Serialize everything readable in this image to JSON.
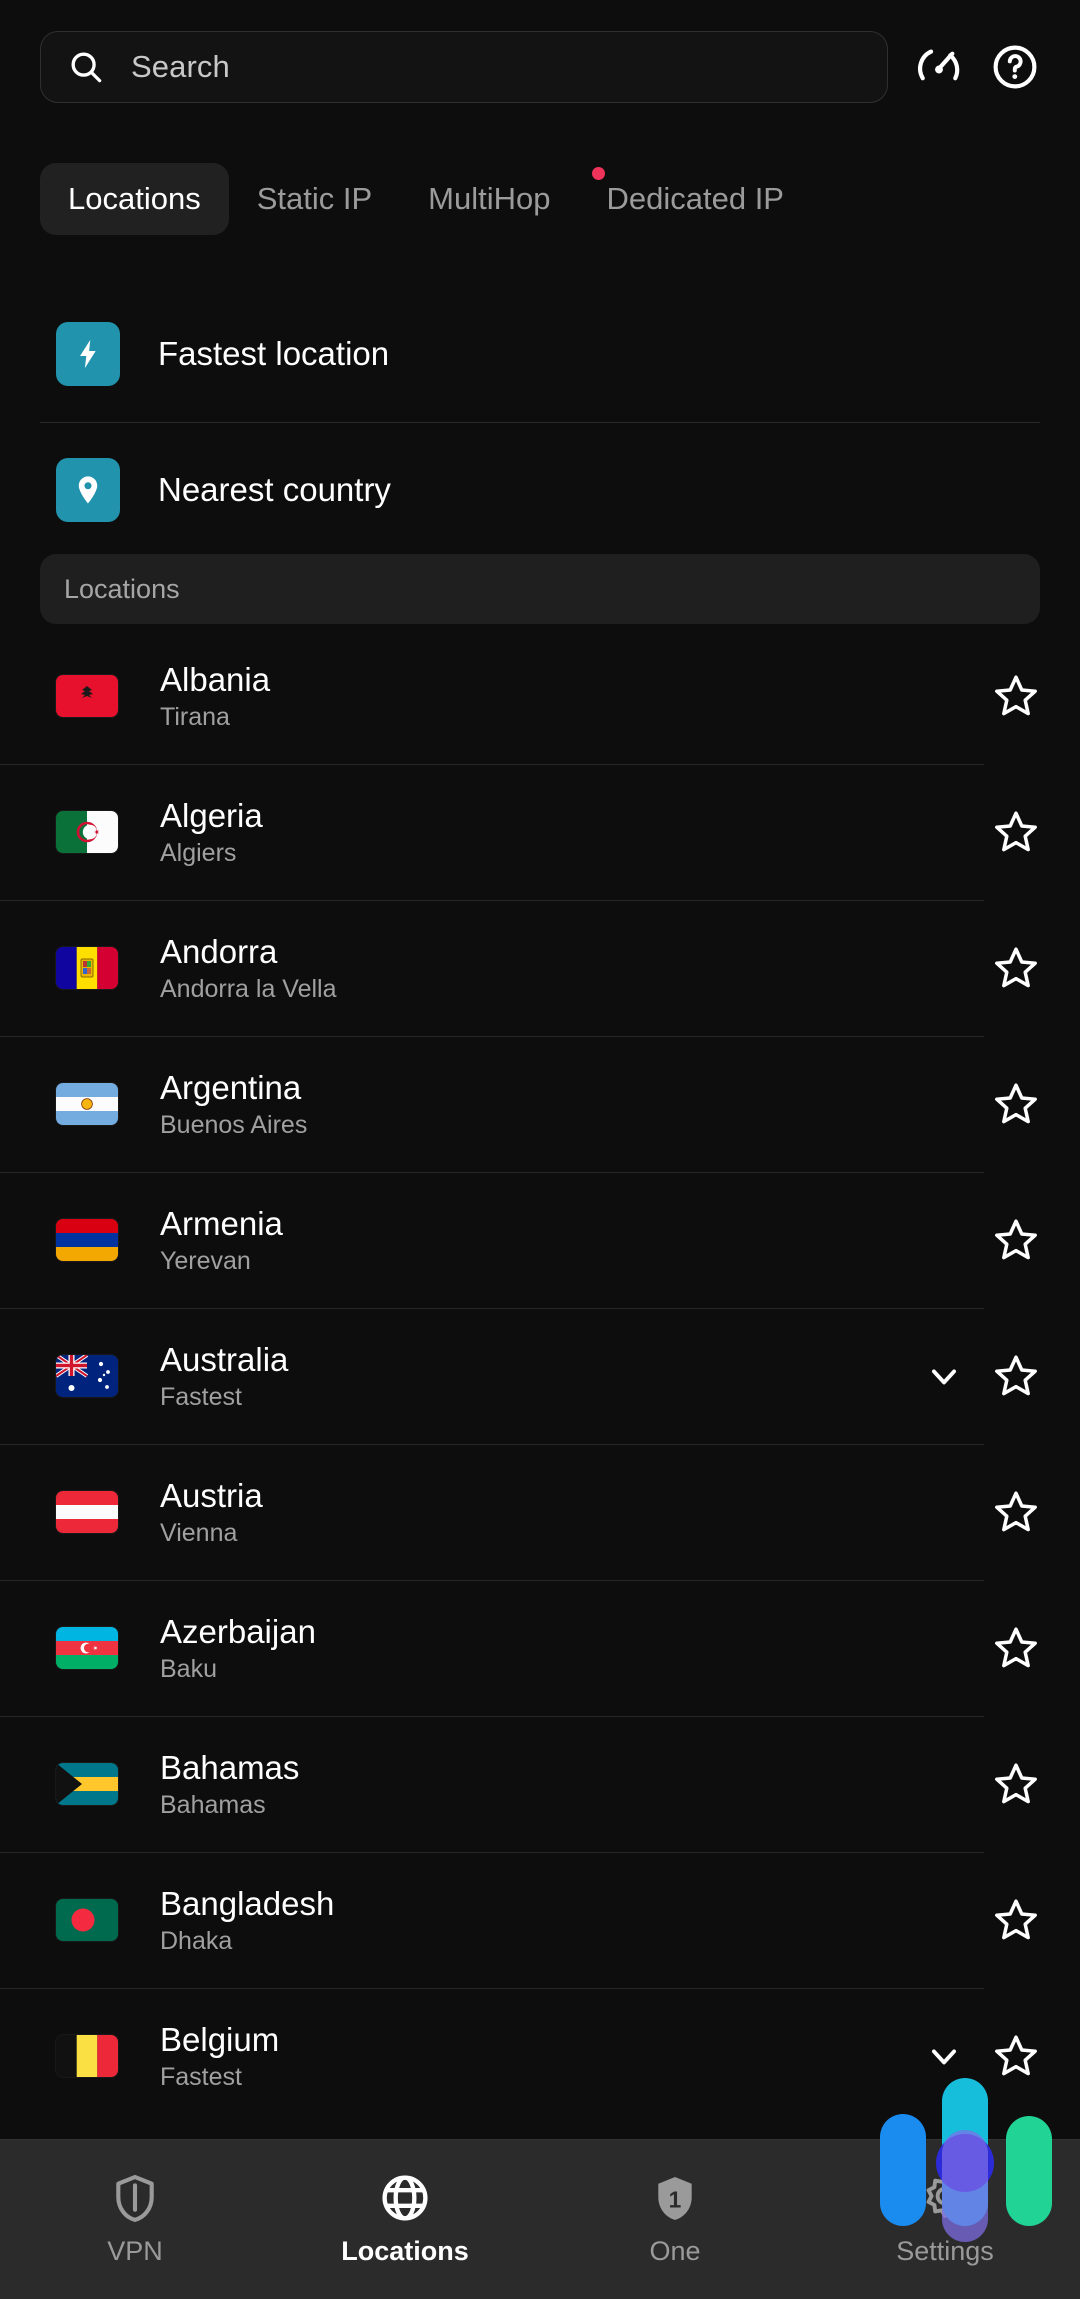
{
  "header": {
    "search": {
      "placeholder": "Search",
      "value": "",
      "icon": "search-icon"
    },
    "icons": [
      {
        "name": "speed-test-icon",
        "label": "Speed test"
      },
      {
        "name": "help-icon",
        "label": "Help"
      }
    ]
  },
  "tabs": [
    {
      "label": "Locations",
      "active": true,
      "dot": false
    },
    {
      "label": "Static IP",
      "active": false,
      "dot": false
    },
    {
      "label": "MultiHop",
      "active": false,
      "dot": false
    },
    {
      "label": "Dedicated IP",
      "active": false,
      "dot": true
    }
  ],
  "quick_actions": [
    {
      "label": "Fastest location",
      "icon": "lightning-icon",
      "color": "#2293ad"
    },
    {
      "label": "Nearest country",
      "icon": "pin-icon",
      "color": "#2293ad"
    }
  ],
  "section": {
    "title": "Locations"
  },
  "countries": [
    {
      "name": "Albania",
      "city": "Tirana",
      "flag": "al",
      "expandable": false,
      "favorite": false
    },
    {
      "name": "Algeria",
      "city": "Algiers",
      "flag": "dz",
      "expandable": false,
      "favorite": false
    },
    {
      "name": "Andorra",
      "city": "Andorra la Vella",
      "flag": "ad",
      "expandable": false,
      "favorite": false
    },
    {
      "name": "Argentina",
      "city": "Buenos Aires",
      "flag": "ar",
      "expandable": false,
      "favorite": false
    },
    {
      "name": "Armenia",
      "city": "Yerevan",
      "flag": "am",
      "expandable": false,
      "favorite": false
    },
    {
      "name": "Australia",
      "city": "Fastest",
      "flag": "au",
      "expandable": true,
      "favorite": false
    },
    {
      "name": "Austria",
      "city": "Vienna",
      "flag": "at",
      "expandable": false,
      "favorite": false
    },
    {
      "name": "Azerbaijan",
      "city": "Baku",
      "flag": "az",
      "expandable": false,
      "favorite": false
    },
    {
      "name": "Bahamas",
      "city": "Bahamas",
      "flag": "bs",
      "expandable": false,
      "favorite": false
    },
    {
      "name": "Bangladesh",
      "city": "Dhaka",
      "flag": "bd",
      "expandable": false,
      "favorite": false
    },
    {
      "name": "Belgium",
      "city": "Fastest",
      "flag": "be",
      "expandable": true,
      "favorite": false
    }
  ],
  "bottom_nav": [
    {
      "label": "VPN",
      "icon": "shield-icon",
      "active": false
    },
    {
      "label": "Locations",
      "icon": "globe-icon",
      "active": true
    },
    {
      "label": "One",
      "icon": "shield-one-icon",
      "active": false
    },
    {
      "label": "Settings",
      "icon": "gear-icon",
      "active": false
    }
  ],
  "floating_widget": {
    "name": "floating-overlay-widget",
    "colors": {
      "blue": "#1a8cf0",
      "cyan": "#17bedb",
      "green": "#22d396",
      "purple": "#7e6ee9",
      "dot": "#2b2bd8"
    }
  },
  "theme": {
    "background": "#0d0d0d",
    "accent": "#2293ad",
    "notification_dot": "#f0335a",
    "nav_background": "#2b2b2b"
  }
}
